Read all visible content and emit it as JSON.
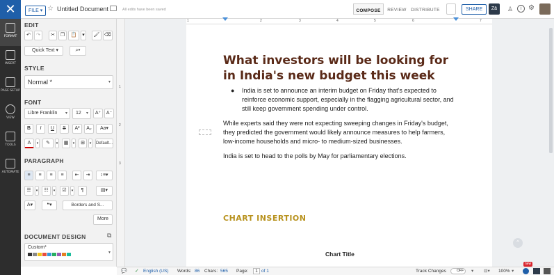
{
  "topbar": {
    "file_label": "FILE",
    "doc_title": "Untitled Document",
    "save_status": "All edits have been saved",
    "tabs": [
      "COMPOSE",
      "REVIEW",
      "DISTRIBUTE"
    ],
    "share_label": "SHARE"
  },
  "rail": {
    "items": [
      "FORMAT",
      "INSERT",
      "PAGE SETUP",
      "VIEW",
      "TOOLS",
      "AUTOMATE"
    ]
  },
  "panel": {
    "edit_title": "EDIT",
    "quick_text": "Quick Text",
    "style_title": "STYLE",
    "style_value": "Normal *",
    "font_title": "FONT",
    "font_family": "Libre Franklin",
    "font_size": "12",
    "default_label": "Default...",
    "paragraph_title": "PARAGRAPH",
    "borders_label": "Borders and S...",
    "more_label": "More",
    "design_title": "DOCUMENT DESIGN",
    "design_value": "Custom*",
    "design_colors": [
      "#333333",
      "#888888",
      "#f0c419",
      "#e74c3c",
      "#3498db",
      "#27ae60",
      "#9b59b6",
      "#e67e22",
      "#1abc9c"
    ]
  },
  "ruler_marks": [
    "1",
    "2",
    "3",
    "4",
    "5",
    "6",
    "7"
  ],
  "left_ruler_marks": [
    "1",
    "2",
    "3"
  ],
  "document": {
    "heading": "What investors will be looking for in India's new budget this week",
    "bullet": "India is set to announce an interim budget on Friday that's expected to reinforce economic support, especially in the flagging agricultural sector, and still keep government spending under control.",
    "para1": "While experts said they were not expecting sweeping changes in Friday's budget, they predicted the government would likely announce measures to help farmers, low-income households and micro- to medium-sized businesses.",
    "para2": "India is set to head to the polls by May for parliamentary elections.",
    "chart_heading": "CHART INSERTION",
    "chart_title": "Chart Title"
  },
  "status": {
    "language": "English (US)",
    "words_label": "Words:",
    "words": "86",
    "chars_label": "Chars:",
    "chars": "565",
    "page_label": "Page:",
    "page_current": "1",
    "page_total": "of 1",
    "track_changes": "Track Changes",
    "track_state": "OFF",
    "zoom": "100%",
    "new_badge": "new"
  }
}
